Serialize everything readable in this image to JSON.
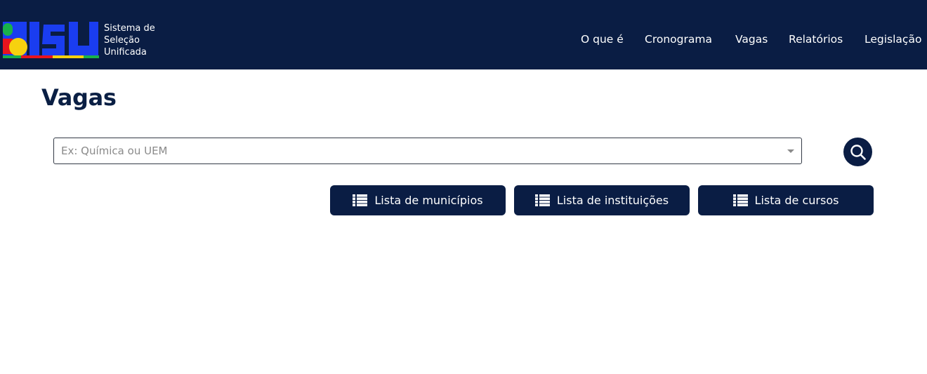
{
  "header": {
    "logo_text": [
      "Sistema de",
      "Seleção",
      "Unificada"
    ],
    "nav": [
      "O que é",
      "Cronograma",
      "Vagas",
      "Relatórios",
      "Legislação"
    ]
  },
  "main": {
    "title": "Vagas",
    "search": {
      "placeholder": "Ex: Química ou UEM",
      "value": ""
    },
    "buttons": [
      {
        "label": "Lista de municípios",
        "icon": "list-icon"
      },
      {
        "label": "Lista de instituições",
        "icon": "list-icon"
      },
      {
        "label": "Lista de cursos",
        "icon": "list-icon"
      }
    ]
  },
  "colors": {
    "navy": "#0a1d44",
    "white": "#ffffff"
  }
}
